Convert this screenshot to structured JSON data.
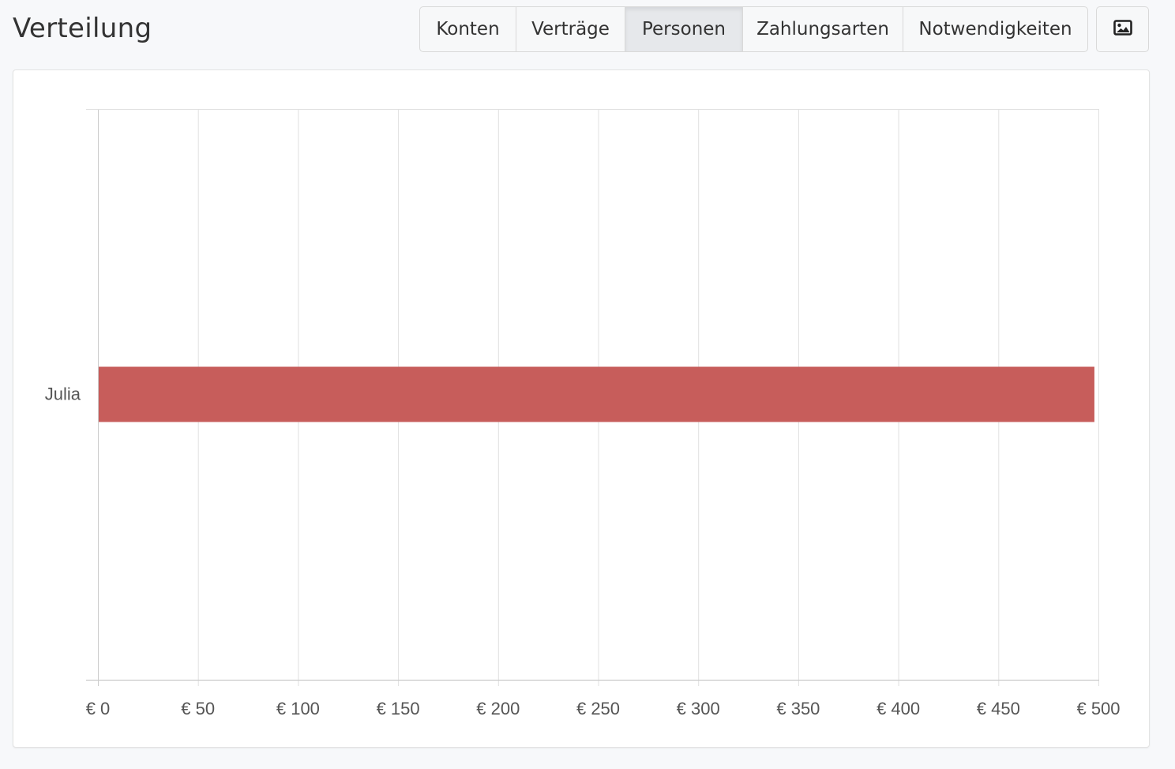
{
  "header": {
    "title": "Verteilung"
  },
  "tabs": [
    {
      "label": "Konten",
      "active": false
    },
    {
      "label": "Verträge",
      "active": false
    },
    {
      "label": "Personen",
      "active": true
    },
    {
      "label": "Zahlungsarten",
      "active": false
    },
    {
      "label": "Notwendigkeiten",
      "active": false
    }
  ],
  "image_button": {
    "icon": "image-icon"
  },
  "colors": {
    "bar": "#c75d5b",
    "grid": "#e0e0e0",
    "axis": "#cccccc"
  },
  "chart_data": {
    "type": "bar",
    "orientation": "horizontal",
    "categories": [
      "Julia"
    ],
    "values": [
      498
    ],
    "xlim": [
      0,
      500
    ],
    "x_ticks": [
      0,
      50,
      100,
      150,
      200,
      250,
      300,
      350,
      400,
      450,
      500
    ],
    "x_tick_labels": [
      "€ 0",
      "€ 50",
      "€ 100",
      "€ 150",
      "€ 200",
      "€ 250",
      "€ 300",
      "€ 350",
      "€ 400",
      "€ 450",
      "€ 500"
    ],
    "grid": true,
    "legend": "none"
  }
}
